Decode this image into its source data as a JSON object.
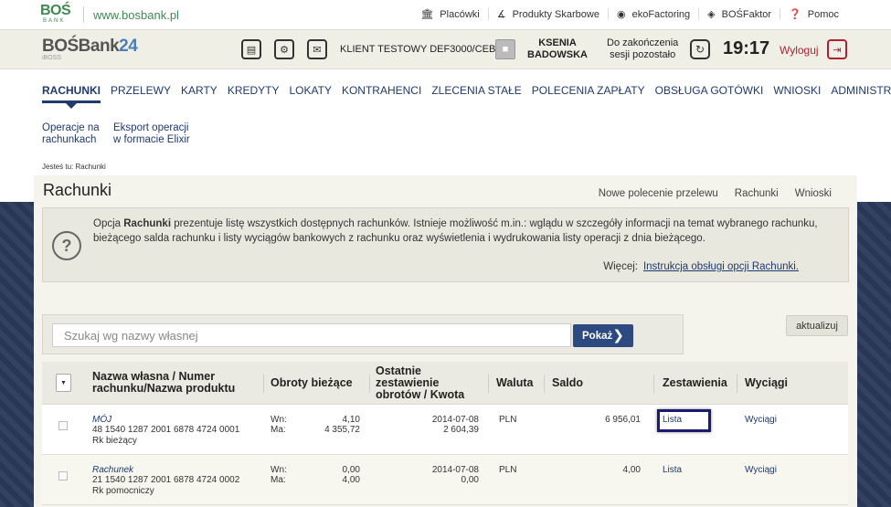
{
  "topbar": {
    "logo": {
      "brand": "BOŚ",
      "sub": "BANK"
    },
    "site_url": "www.bosbank.pl",
    "links": [
      {
        "label": "Placówki",
        "icon": "bank-icon"
      },
      {
        "label": "Produkty Skarbowe",
        "icon": "chart-icon"
      },
      {
        "label": "ekoFactoring",
        "icon": "factoring-icon"
      },
      {
        "label": "BOŚFaktor",
        "icon": "handshake-icon"
      },
      {
        "label": "Pomoc",
        "icon": "help-icon"
      }
    ]
  },
  "header": {
    "brand_main": "BOŚBank",
    "brand_num": "24",
    "brand_sub": "iBOSS",
    "client": "KLIENT TESTOWY DEF3000/CEB",
    "user_first": "KSENIA",
    "user_last": "BADOWSKA",
    "session_line1": "Do zakończenia",
    "session_line2": "sesji pozostało",
    "time": "19:17",
    "logout": "Wyloguj"
  },
  "nav": {
    "items": [
      "RACHUNKI",
      "PRZELEWY",
      "KARTY",
      "KREDYTY",
      "LOKATY",
      "KONTRAHENCI",
      "ZLECENIA STAŁE",
      "POLECENIA ZAPŁATY",
      "OBSŁUGA GOTÓWKI",
      "WNIOSKI",
      "ADMINISTRACJA"
    ]
  },
  "subnav": {
    "item1_l1": "Operacje na",
    "item1_l2": "rachunkach",
    "item2_l1": "Eksport operacji",
    "item2_l2": "w formacie Elixir"
  },
  "breadcrumb": {
    "prefix": "Jesteś tu:",
    "current": "Rachunki"
  },
  "page": {
    "title": "Rachunki",
    "links": [
      "Nowe polecenie przelewu",
      "Rachunki",
      "Wnioski"
    ]
  },
  "info": {
    "text_pre": "Opcja ",
    "text_bold": "Rachunki",
    "text_post": " prezentuje listę wszystkich dostępnych rachunków. Istnieje możliwość m.in.: wglądu w szczegóły informacji na temat wybranego rachunku, bieżącego salda rachunku i listy wyciągów bankowych z rachunku oraz wyświetlenia i wydrukowania listy operacji z dnia bieżącego.",
    "more_label": "Więcej:",
    "more_link": "Instrukcja obsługi opcji Rachunki."
  },
  "search": {
    "placeholder": "Szukaj wg nazwy własnej",
    "button": "Pokaż",
    "refresh": "aktualizuj"
  },
  "table": {
    "headers": {
      "name_l1": "Nazwa własna / Numer",
      "name_l2": "rachunku/Nazwa produktu",
      "turnover": "Obroty bieżące",
      "last_l1": "Ostatnie",
      "last_l2": "zestawienie",
      "last_l3": "obrotów / Kwota",
      "currency": "Waluta",
      "balance": "Saldo",
      "statement": "Zestawienia",
      "extracts": "Wyciągi"
    },
    "rows": [
      {
        "name": "MÓJ",
        "number": "48 1540 1287 2001 6878 4724 0001",
        "product": "Rk bieżący",
        "wn_label": "Wn:",
        "ma_label": "Ma:",
        "wn": "4,10",
        "ma": "4 355,72",
        "last_date": "2014-07-08",
        "last_amount": "2 604,39",
        "currency": "PLN",
        "balance": "6 956,01",
        "statement": "Lista",
        "extracts": "Wyciągi"
      },
      {
        "name": "Rachunek",
        "number": "21 1540 1287 2001 6878 4724 0002",
        "product": "Rk pomocniczy",
        "wn_label": "Wn:",
        "ma_label": "Ma:",
        "wn": "0,00",
        "ma": "4,00",
        "last_date": "2014-07-08",
        "last_amount": "0,00",
        "currency": "PLN",
        "balance": "4,00",
        "statement": "Lista",
        "extracts": "Wyciągi"
      }
    ]
  },
  "colors": {
    "brand_green": "#3d8a4f",
    "nav_blue": "#1e3a6e",
    "logout_red": "#b22030",
    "button_blue": "#2c4a80"
  }
}
